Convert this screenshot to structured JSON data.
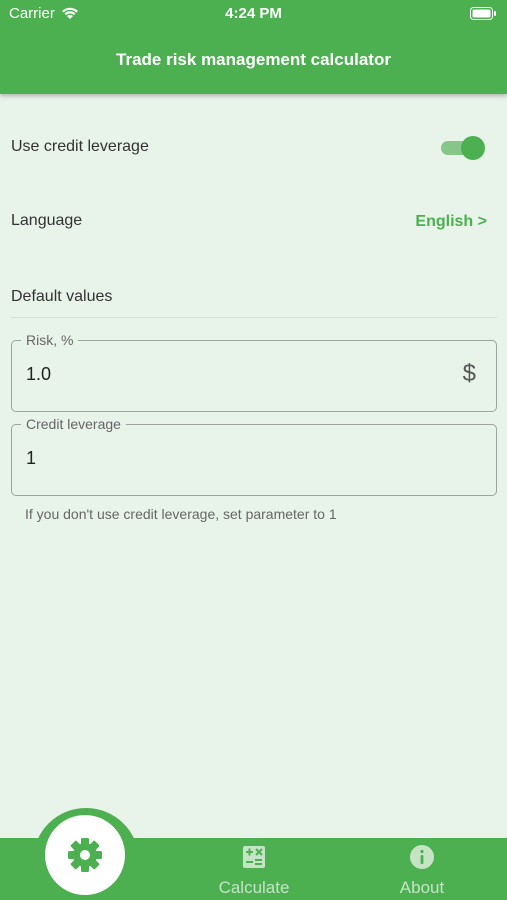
{
  "status_bar": {
    "carrier": "Carrier",
    "time": "4:24 PM"
  },
  "header": {
    "title": "Trade risk management calculator"
  },
  "settings": {
    "leverage": {
      "label": "Use credit leverage",
      "enabled": true
    },
    "language": {
      "label": "Language",
      "value": "English >"
    },
    "defaults": {
      "label": "Default values"
    }
  },
  "fields": {
    "risk": {
      "label": "Risk, %",
      "value": "1.0",
      "suffix_icon": "dollar-icon",
      "suffix_text": "$"
    },
    "leverage": {
      "label": "Credit leverage",
      "value": "1",
      "helper": "If you don't use credit leverage, set parameter to 1"
    }
  },
  "bottom_nav": {
    "active": "settings",
    "items": [
      {
        "id": "settings",
        "icon": "gear-icon",
        "label": ""
      },
      {
        "id": "calculate",
        "icon": "calculator-icon",
        "label": "Calculate"
      },
      {
        "id": "about",
        "icon": "info-icon",
        "label": "About"
      }
    ]
  },
  "colors": {
    "primary": "#4caf50",
    "background": "#e8f3ea",
    "nav_inactive": "#c5e4c6"
  }
}
